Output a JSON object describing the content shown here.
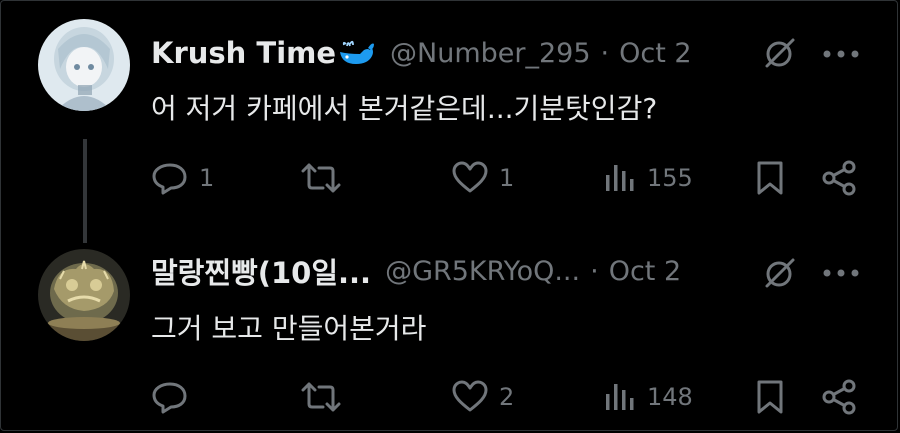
{
  "tweets": [
    {
      "display_name": "Krush Time",
      "handle": "@Number_295",
      "separator": "·",
      "date": "Oct 2",
      "text": "어 저거 카페에서 본거같은데...기분탓인감?",
      "replies": "1",
      "retweets": "",
      "likes": "1",
      "views": "155",
      "avatar_icon": "anime-girl-avatar",
      "badge_icon": "whale-icon"
    },
    {
      "display_name": "말랑찐빵(10일...",
      "handle": "@GR5KRYoQ...",
      "separator": "·",
      "date": "Oct 2",
      "text": "그거 보고 만들어본거라",
      "replies": "",
      "retweets": "",
      "likes": "2",
      "views": "148",
      "avatar_icon": "gold-figurine-avatar"
    }
  ],
  "colors": {
    "background": "#000000",
    "text": "#e7e9ea",
    "muted": "#71767b",
    "whale": "#1d9bf0",
    "thread_line": "#333639"
  }
}
